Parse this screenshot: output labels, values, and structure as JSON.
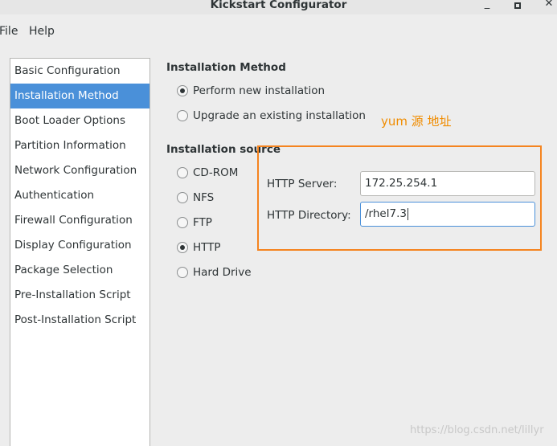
{
  "window": {
    "title": "Kickstart Configurator",
    "minimize": "_",
    "close": "✕"
  },
  "menu": {
    "file": "File",
    "help": "Help"
  },
  "sidebar": {
    "items": [
      "Basic Configuration",
      "Installation Method",
      "Boot Loader Options",
      "Partition Information",
      "Network Configuration",
      "Authentication",
      "Firewall Configuration",
      "Display Configuration",
      "Package Selection",
      "Pre-Installation Script",
      "Post-Installation Script"
    ],
    "selected": "Installation Method"
  },
  "install_method": {
    "heading": "Installation Method",
    "options": [
      "Perform new installation",
      "Upgrade an existing installation"
    ],
    "selected": "Perform new installation"
  },
  "install_source": {
    "heading": "Installation source",
    "options": [
      "CD-ROM",
      "NFS",
      "FTP",
      "HTTP",
      "Hard Drive"
    ],
    "selected": "HTTP"
  },
  "annotation": "yum 源 地址",
  "http": {
    "server_label": "HTTP Server:",
    "server_value": "172.25.254.1",
    "directory_label": "HTTP Directory:",
    "directory_value": "/rhel7.3"
  },
  "watermark": "https://blog.csdn.net/lillyr",
  "colors": {
    "selection": "#4a90d9",
    "highlight_box": "#f5841f",
    "annotation": "#f08c00"
  }
}
